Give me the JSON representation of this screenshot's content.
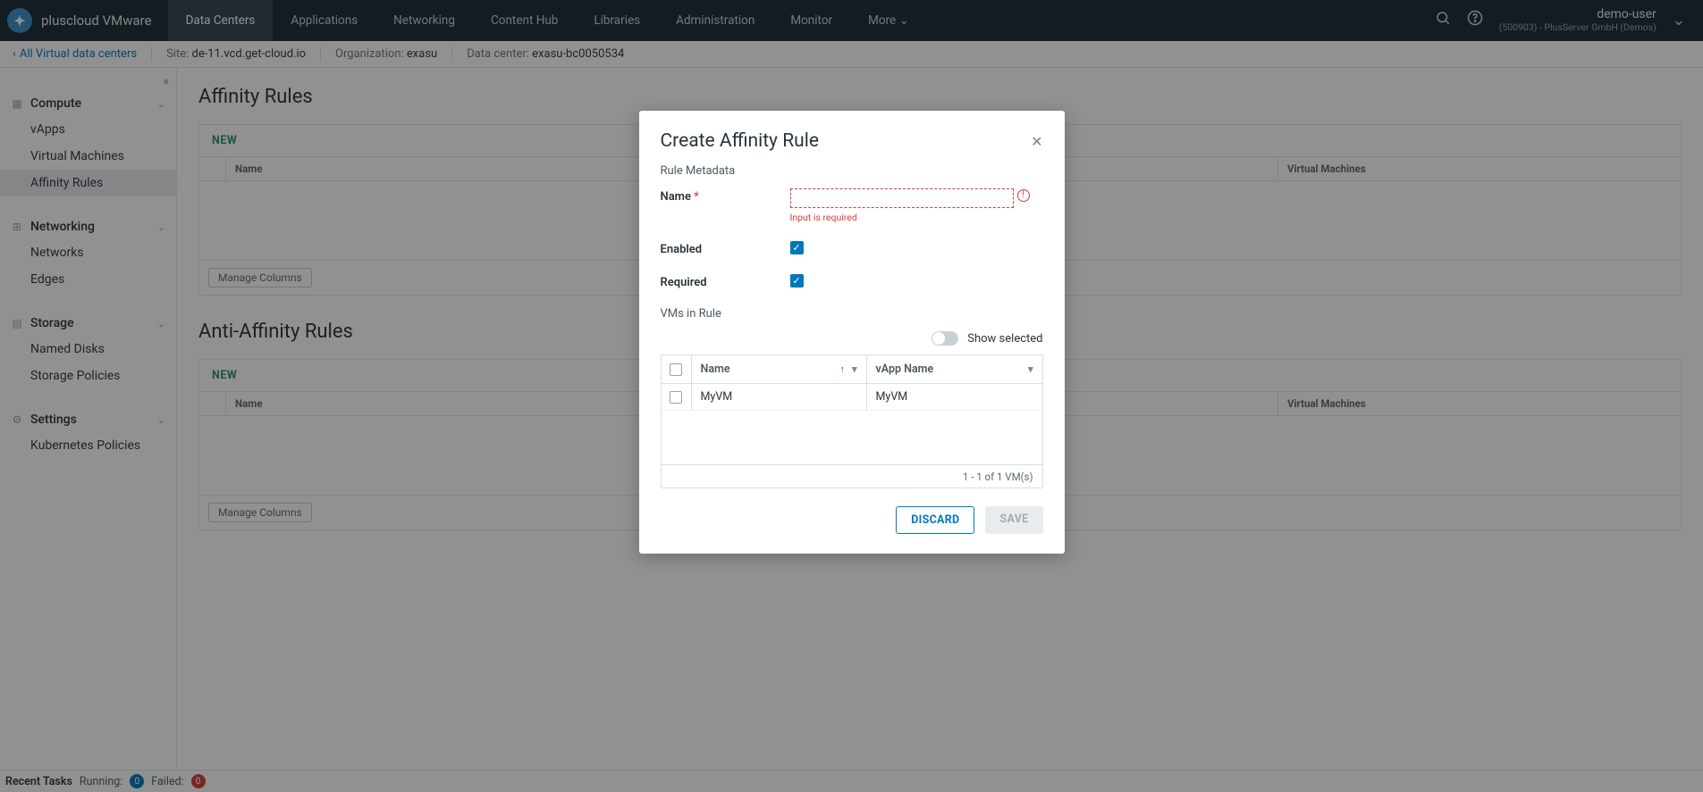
{
  "brand": {
    "name": "pluscloud VMware"
  },
  "nav": {
    "items": [
      "Data Centers",
      "Applications",
      "Networking",
      "Content Hub",
      "Libraries",
      "Administration",
      "Monitor",
      "More"
    ],
    "active_index": 0
  },
  "user": {
    "name": "demo-user",
    "org": "(500903) - PlusServer GmbH (Demos)"
  },
  "breadcrumb": {
    "back": "All Virtual data centers",
    "site_key": "Site:",
    "site_val": "de-11.vcd.get-cloud.io",
    "org_key": "Organization:",
    "org_val": "exasu",
    "dc_key": "Data center:",
    "dc_val": "exasu-bc0050534"
  },
  "sidebar": {
    "compute": {
      "label": "Compute",
      "items": [
        "vApps",
        "Virtual Machines",
        "Affinity Rules"
      ],
      "active_index": 2
    },
    "networking": {
      "label": "Networking",
      "items": [
        "Networks",
        "Edges"
      ]
    },
    "storage": {
      "label": "Storage",
      "items": [
        "Named Disks",
        "Storage Policies"
      ]
    },
    "settings": {
      "label": "Settings",
      "items": [
        "Kubernetes Policies"
      ]
    }
  },
  "main": {
    "section1": "Affinity Rules",
    "section2": "Anti-Affinity Rules",
    "new": "NEW",
    "col_name": "Name",
    "col_vms": "Virtual Machines",
    "manage_cols": "Manage Columns"
  },
  "status": {
    "label": "Recent Tasks",
    "running_key": "Running:",
    "running_val": "0",
    "failed_key": "Failed:",
    "failed_val": "0"
  },
  "dialog": {
    "title": "Create Affinity Rule",
    "rule_meta": "Rule Metadata",
    "name_label": "Name",
    "name_error": "Input is required",
    "enabled_label": "Enabled",
    "required_label": "Required",
    "vms_in_rule": "VMs in Rule",
    "show_selected": "Show selected",
    "grid": {
      "col_name": "Name",
      "col_vapp": "vApp Name",
      "row": {
        "name": "MyVM",
        "vapp": "MyVM"
      },
      "footer": "1 - 1 of 1 VM(s)"
    },
    "discard": "DISCARD",
    "save": "SAVE"
  }
}
